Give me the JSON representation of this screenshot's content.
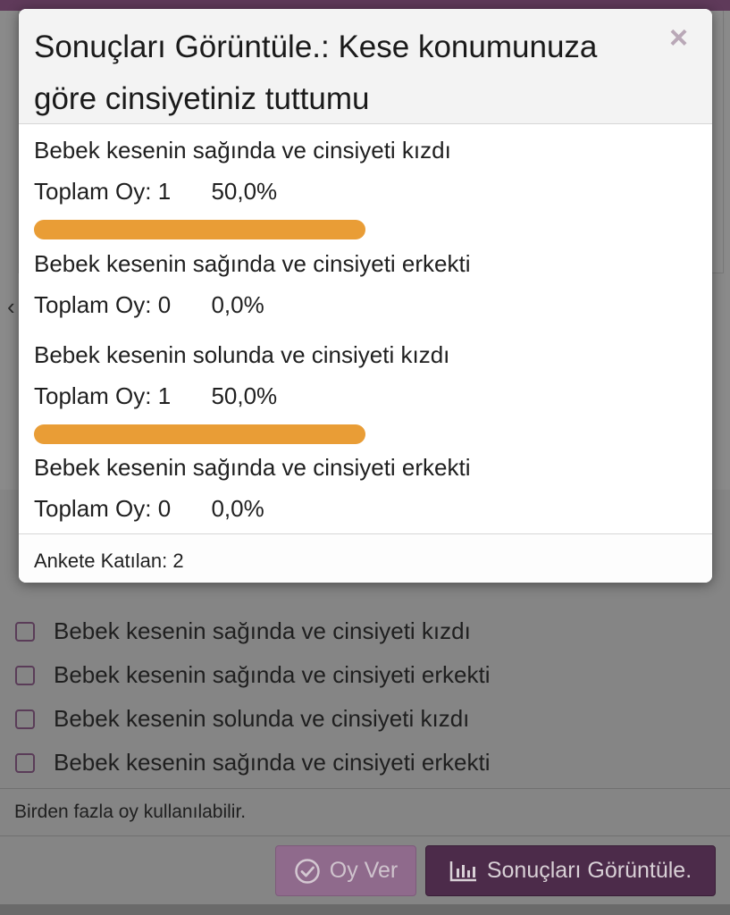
{
  "modal": {
    "title": "Sonuçları Görüntüle.: Kese konumunuza göre cinsiyetiniz tuttumu",
    "close_symbol": "×",
    "votes_prefix": "Toplam Oy:",
    "results": [
      {
        "label": "Bebek kesenin sağında ve cinsiyeti kızdı",
        "votes": "1",
        "percent": "50,0%",
        "fraction": 0.5
      },
      {
        "label": "Bebek kesenin sağında ve cinsiyeti erkekti",
        "votes": "0",
        "percent": "0,0%",
        "fraction": 0.0
      },
      {
        "label": "Bebek kesenin solunda ve cinsiyeti kızdı",
        "votes": "1",
        "percent": "50,0%",
        "fraction": 0.5
      },
      {
        "label": "Bebek kesenin sağında ve cinsiyeti erkekti",
        "votes": "0",
        "percent": "0,0%",
        "fraction": 0.0
      }
    ],
    "footer": "Ankete Katılan: 2",
    "bar_color": "#e99d36"
  },
  "poll": {
    "options": [
      "Bebek kesenin sağında ve cinsiyeti kızdı",
      "Bebek kesenin sağında ve cinsiyeti erkekti",
      "Bebek kesenin solunda ve cinsiyeti kızdı",
      "Bebek kesenin sağında ve cinsiyeti erkekti"
    ],
    "multi_note": "Birden fazla oy kullanılabilir.",
    "vote_button": "Oy Ver",
    "results_button": "Sonuçları Görüntüle."
  },
  "icons": {
    "close": "close-icon",
    "vote": "check-circle-icon",
    "results": "bar-chart-icon"
  },
  "colors": {
    "brand_dark": "#4c2b4a",
    "brand_light": "#8f6a8c"
  }
}
